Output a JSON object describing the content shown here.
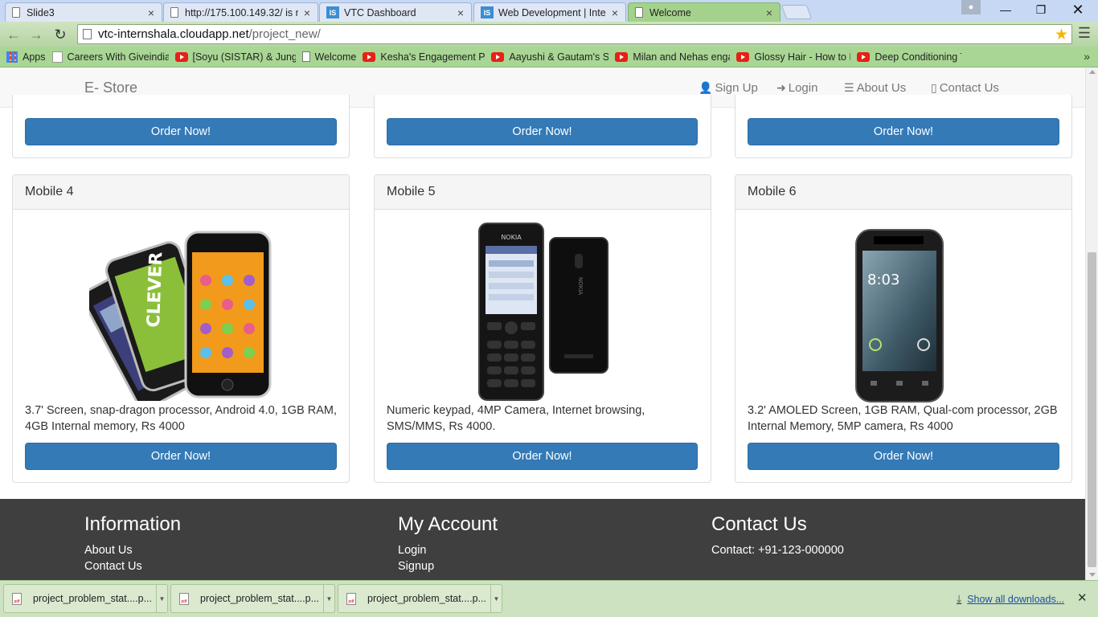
{
  "browser": {
    "tabs": [
      {
        "title": "Slide3",
        "icon": "doc"
      },
      {
        "title": "http://175.100.149.32/ is n",
        "icon": "doc"
      },
      {
        "title": "VTC Dashboard",
        "icon": "is",
        "icon_text": "IS"
      },
      {
        "title": "Web Development | Intern",
        "icon": "is",
        "icon_text": "IS"
      },
      {
        "title": "Welcome",
        "icon": "doc",
        "active": true
      }
    ],
    "url_host": "vtc-internshala.cloudapp.net",
    "url_path": "/project_new/",
    "bookmarks": [
      {
        "label": "Apps",
        "icon": "grid"
      },
      {
        "label": "Careers With Giveindia",
        "icon": "gv"
      },
      {
        "label": "[Soyu (SISTAR) & Jung",
        "icon": "youtube"
      },
      {
        "label": "Welcome",
        "icon": "doc"
      },
      {
        "label": "Kesha's Engagement P",
        "icon": "youtube"
      },
      {
        "label": "Aayushi & Gautam's S",
        "icon": "youtube"
      },
      {
        "label": "Milan and Nehas enga",
        "icon": "youtube"
      },
      {
        "label": "Glossy Hair - How to P",
        "icon": "youtube"
      },
      {
        "label": "Deep Conditioning Tre",
        "icon": "youtube"
      }
    ]
  },
  "site": {
    "brand": "E- Store",
    "nav": [
      {
        "label": "Sign Up",
        "icon": "user-icon"
      },
      {
        "label": "Login",
        "icon": "login-icon"
      },
      {
        "label": "About Us",
        "icon": "list-icon"
      },
      {
        "label": "Contact Us",
        "icon": "phone-icon"
      }
    ],
    "order_label": "Order Now!",
    "products": [
      {
        "name": "Mobile 4",
        "description": "3.7' Screen, snap-dragon processor, Android 4.0, 1GB RAM, 4GB Internal memory, Rs 4000",
        "image": "iphone-stack"
      },
      {
        "name": "Mobile 5",
        "description": "Numeric keypad, 4MP Camera, Internet browsing, SMS/MMS, Rs 4000.",
        "image": "nokia-keypad",
        "image_text": "NOKIA"
      },
      {
        "name": "Mobile 6",
        "description": "3.2' AMOLED Screen, 1GB RAM, Qual-com processor, 2GB Internal Memory, 5MP camera, Rs 4000",
        "image": "android-phone",
        "image_text": "8:03"
      }
    ],
    "footer": {
      "information": {
        "heading": "Information",
        "links": [
          "About Us",
          "Contact Us"
        ]
      },
      "account": {
        "heading": "My Account",
        "links": [
          "Login",
          "Signup"
        ]
      },
      "contact": {
        "heading": "Contact Us",
        "text": "Contact: +91-123-000000"
      }
    }
  },
  "downloads": {
    "items": [
      "project_problem_stat....p...",
      "project_problem_stat....p...",
      "project_problem_stat....p..."
    ],
    "show_all": "Show all downloads..."
  }
}
